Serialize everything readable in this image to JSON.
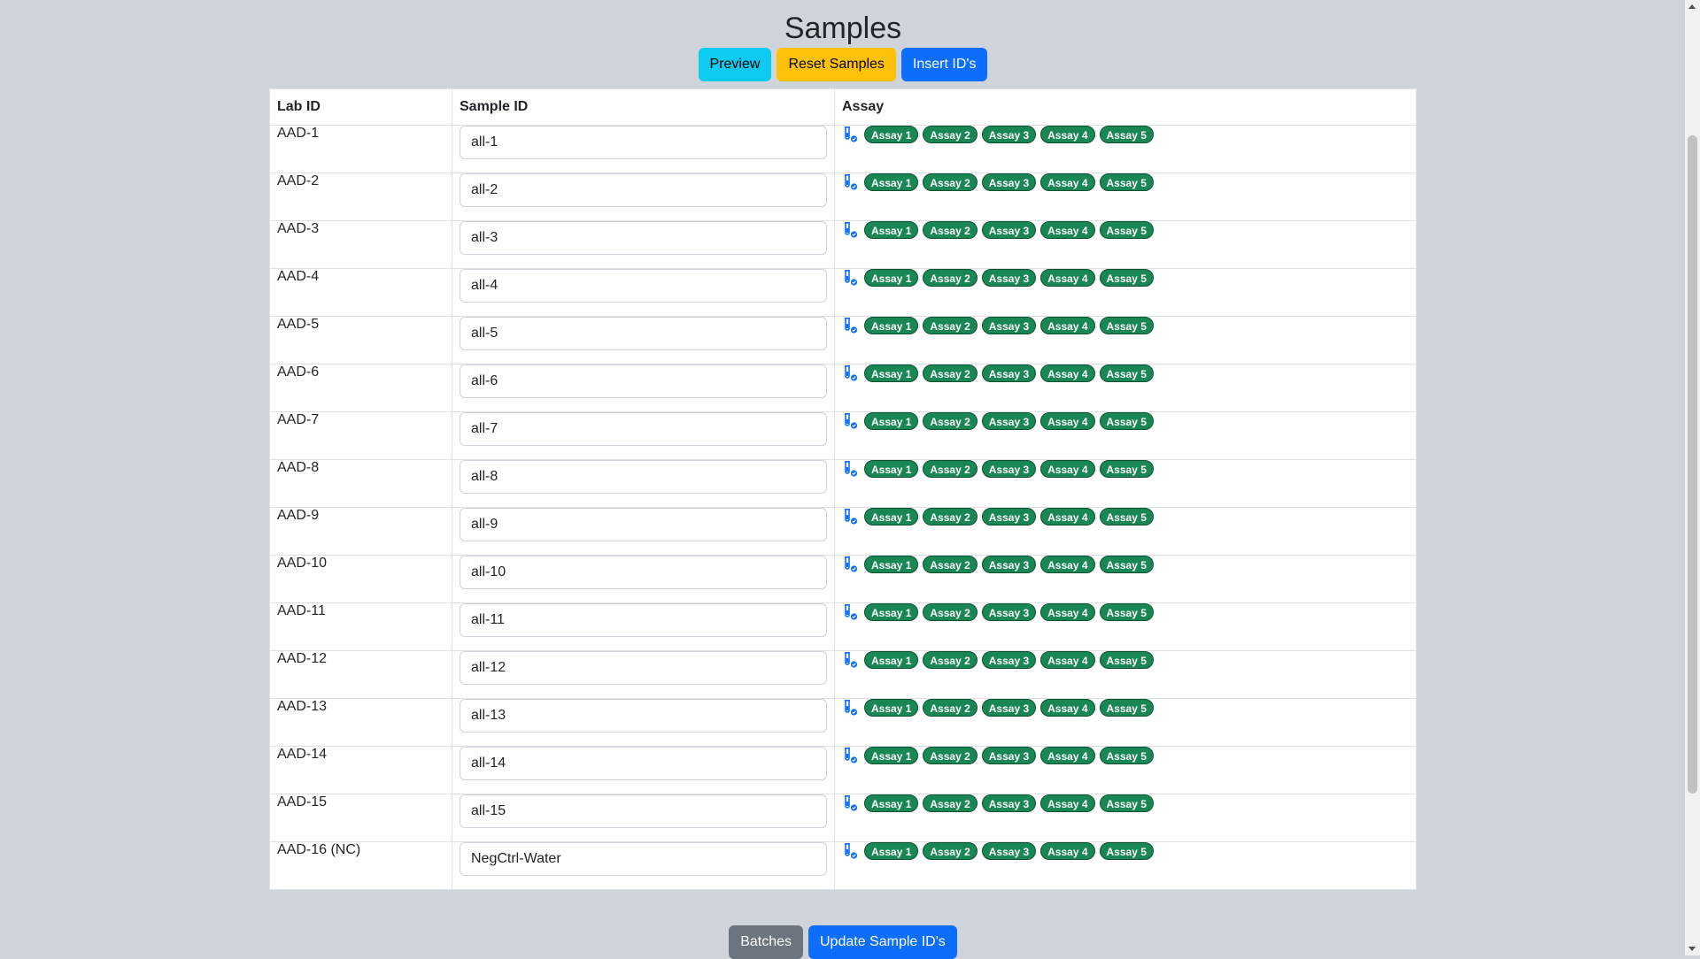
{
  "page": {
    "title": "Samples"
  },
  "actions": {
    "preview_label": "Preview",
    "reset_label": "Reset Samples",
    "insert_label": "Insert ID's"
  },
  "table": {
    "headers": {
      "lab_id": "Lab ID",
      "sample_id": "Sample ID",
      "assay": "Assay"
    },
    "assays": [
      "Assay 1",
      "Assay 2",
      "Assay 3",
      "Assay 4",
      "Assay 5"
    ],
    "rows": [
      {
        "lab_id": "AAD-1",
        "sample_id": "all-1"
      },
      {
        "lab_id": "AAD-2",
        "sample_id": "all-2"
      },
      {
        "lab_id": "AAD-3",
        "sample_id": "all-3"
      },
      {
        "lab_id": "AAD-4",
        "sample_id": "all-4"
      },
      {
        "lab_id": "AAD-5",
        "sample_id": "all-5"
      },
      {
        "lab_id": "AAD-6",
        "sample_id": "all-6"
      },
      {
        "lab_id": "AAD-7",
        "sample_id": "all-7"
      },
      {
        "lab_id": "AAD-8",
        "sample_id": "all-8"
      },
      {
        "lab_id": "AAD-9",
        "sample_id": "all-9"
      },
      {
        "lab_id": "AAD-10",
        "sample_id": "all-10"
      },
      {
        "lab_id": "AAD-11",
        "sample_id": "all-11"
      },
      {
        "lab_id": "AAD-12",
        "sample_id": "all-12"
      },
      {
        "lab_id": "AAD-13",
        "sample_id": "all-13"
      },
      {
        "lab_id": "AAD-14",
        "sample_id": "all-14"
      },
      {
        "lab_id": "AAD-15",
        "sample_id": "all-15"
      },
      {
        "lab_id": "AAD-16 (NC)",
        "sample_id": "NegCtrl-Water"
      }
    ]
  },
  "footer": {
    "batches_label": "Batches",
    "update_label": "Update Sample ID's"
  },
  "icons": {
    "assay_row_icon": "test-tube-check-icon"
  },
  "colors": {
    "background": "#ced4da",
    "badge": "#198754",
    "primary": "#0d6efd",
    "info": "#0dcaf0",
    "warning": "#ffc107",
    "secondary": "#6c757d"
  }
}
